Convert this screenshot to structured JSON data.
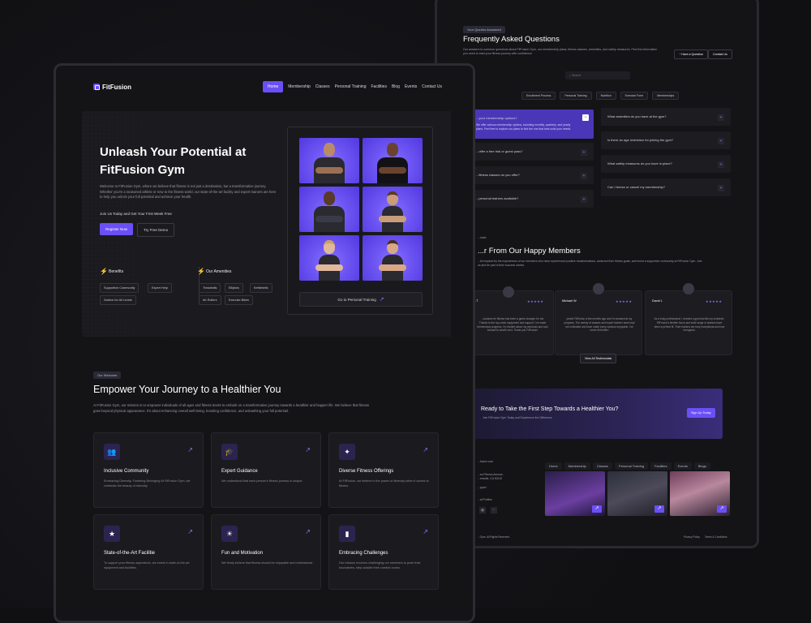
{
  "brand": {
    "name": "FitFusion",
    "accent": "#6b4ff6"
  },
  "nav": {
    "items": [
      "Home",
      "Membership",
      "Classes",
      "Personal Training",
      "Facilities",
      "Blog",
      "Events",
      "Contact Us"
    ],
    "active": "Home"
  },
  "hero": {
    "title": "Unleash Your Potential at FitFusion Gym",
    "description": "Welcome to FitFusion Gym, where we believe that fitness is not just a destination, but a transformative journey. Whether you're a seasoned athlete or new to the fitness world, our state-of-the-art facility and expert trainers are here to help you unlock your full potential and achieve your health.",
    "join_text": "Join Us Today and Get Your First Week Free",
    "register_label": "Register Now",
    "demo_label": "Try Free Demo",
    "benefits_heading": "Benefits",
    "benefits": [
      "Supportive Community",
      "Expert Help",
      "Zestive for All Levels"
    ],
    "amenities_heading": "Our Amenities",
    "amenities": [
      "Treadmills",
      "Elliptcis",
      "Kettlebells",
      "Ab Rollers",
      "Exercise Bikes"
    ],
    "personal_training_label": "Go to Personal Training"
  },
  "welcome": {
    "pill": "Our Welcome",
    "title": "Empower Your Journey to a Healthier You",
    "description": "At FitFusion Gym, our mission is to empower individuals of all ages and fitness levels to embark on a transformative journey towards a healthier and happier life. We believe that fitness goes beyond physical appearance. It's about enhancing overall well-being, boosting confidence, and unleashing your full potential.",
    "features": [
      {
        "icon": "community-icon",
        "glyph": "👥",
        "title": "Inclusive Community",
        "desc": "Embracing Diversity, Fostering Belonging At FitFusion Gym, we celebrate the beauty of diversity."
      },
      {
        "icon": "graduation-cap-icon",
        "glyph": "🎓",
        "title": "Expert Guidance",
        "desc": "We understand that each person's fitness journey is unique."
      },
      {
        "icon": "sparkle-icon",
        "glyph": "✦",
        "title": "Diverse Fitness Offerings",
        "desc": "At FitFusion, we believe in the power of diversity when it comes to fitness."
      },
      {
        "icon": "star-icon",
        "glyph": "★",
        "title": "State-of-the-Art Facilitie",
        "desc": "To support your fitness aspirations, we invest in state-of-the-art equipment and facilities."
      },
      {
        "icon": "sun-icon",
        "glyph": "☀",
        "title": "Fun and Motivation",
        "desc": "We firmly believe that fitness should be enjoyable and motivational."
      },
      {
        "icon": "bar-chart-icon",
        "glyph": "▮",
        "title": "Embracing Challenges",
        "desc": "Our mission involves challenging our members to push their boundaries, step outside their comfort zones."
      }
    ]
  },
  "faq": {
    "pill": "Your Queries Answered",
    "title": "Frequently Asked Questions",
    "description": "Our answers to common questions about FitFusion Gym, our membership plans, fitness classes, amenities, and safety measures. Find the information you need to start your fitness journey with confidence.",
    "have_question_label": "Have a Question",
    "contact_label": "Contact Us",
    "search_placeholder": "Search",
    "tabs": [
      "Enrollment Process",
      "Personal Training",
      "Nutrition",
      "Exercise Form",
      "Memberships"
    ],
    "left_questions": [
      {
        "q": "...your membership options?",
        "open": true,
        "answer": "We offer various membership options, including monthly, quarterly, and yearly plans. Feel free to explore our plans to find the one that best suits your needs."
      },
      {
        "q": "...offer a free trial or guest pass?",
        "open": false
      },
      {
        "q": "...fitness classes do you offer?",
        "open": false
      },
      {
        "q": "...personal trainers available?",
        "open": false
      }
    ],
    "right_questions": [
      "What amenities do you have at the gym?",
      "Is there an age restriction for joining the gym?",
      "What safety measures do you have in place?",
      "Can I freeze or cancel my membership?"
    ]
  },
  "testimonials": {
    "pill": "...nials",
    "title": "...r From Our Happy Members",
    "description": "...be inspired by the experiences of our members who have experienced positive transformations, achieved their fitness goals, and found a supportive community at FitFusion Gym. Join us and be part of their success stories.",
    "cards": [
      {
        "name": "...T",
        "text": "...ousiasm for fitness has been a game-changer for me. Thanks to the top-notch equipment and support. I've made tremendous progress. I'm excited about my workouts and look forward to what's next. Thank you FitFusion!"
      },
      {
        "name": "Michael W",
        "text": "joined FitFusion a few months ago and I'm amazed at my progress. The variety of classes and expert trainers have kept me motivated and have made every workout enjoyable. I've never felt better!"
      },
      {
        "name": "David L",
        "text": "As a busy professional, I needed a gym that fits my schedule. FitFusion's flexible hours and wide range of classes have been a perfect fit. Their trainers are truly exceptional and now energized."
      }
    ],
    "view_all_label": "View All Testimonials"
  },
  "cta": {
    "title": "Ready to Take the First Step Towards a Healthier You?",
    "subtitle": "Join FitFusion Gym Today and Experience the Difference",
    "button": "Sign Up Today"
  },
  "footer": {
    "nav": [
      "Home",
      "Membership",
      "Classes",
      "Personal Training",
      "Facilities",
      "Events",
      "Blogs"
    ],
    "email": "...fusion.com",
    "address_line1": "...an Fitness Avenue,",
    "address_line2": "...ersville, CA 90210",
    "support": "...pport",
    "profiles": "...al Profiles",
    "copyright": "...Gym. All Rights Reserved.",
    "privacy": "Privacy Policy",
    "terms": "Terms & Conditions"
  }
}
